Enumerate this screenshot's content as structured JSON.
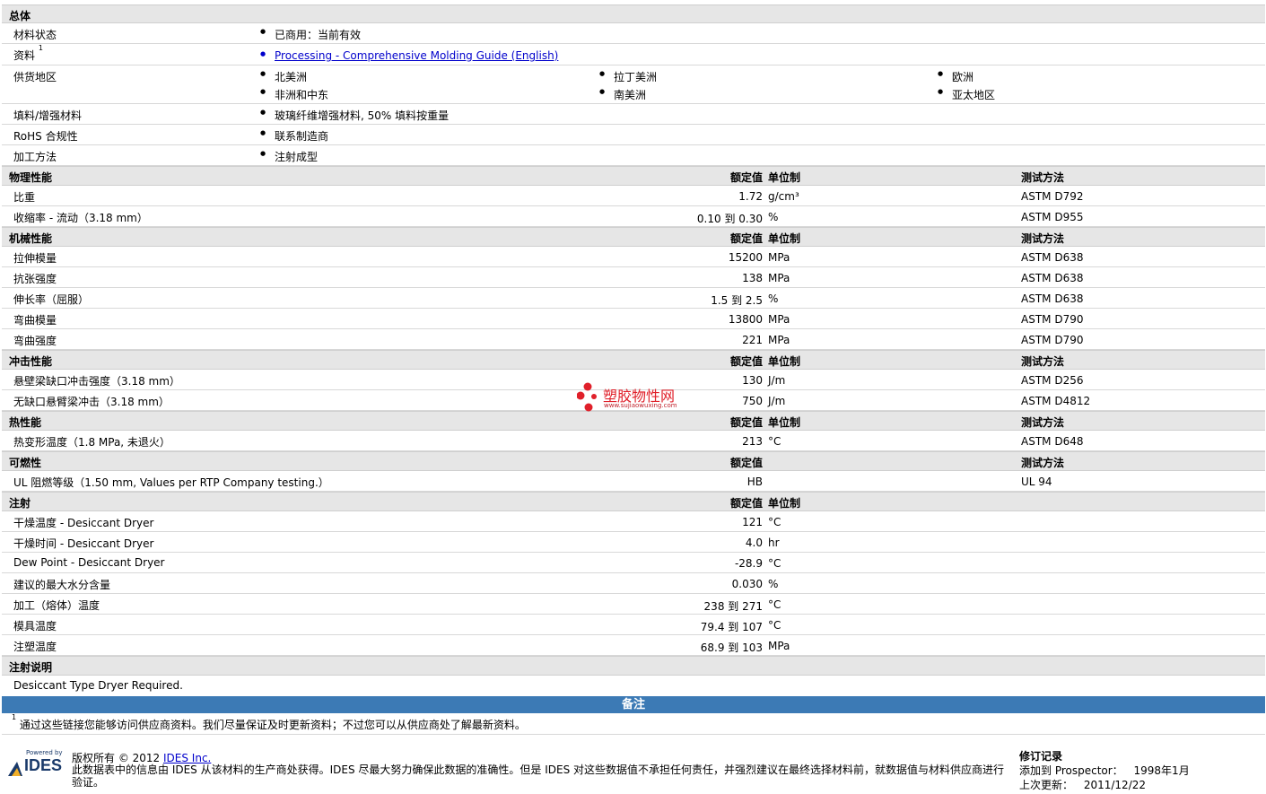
{
  "general": {
    "title": "总体",
    "rows": [
      {
        "label": "材料状态",
        "items": [
          "已商用：当前有效"
        ]
      },
      {
        "label": "资料",
        "sup": "1",
        "link": "Processing - Comprehensive Molding Guide (English)"
      },
      {
        "label": "供货地区",
        "regions": [
          "北美洲",
          "拉丁美洲",
          "欧洲",
          "非洲和中东",
          "南美洲",
          "亚太地区"
        ]
      },
      {
        "label": "填料/增强材料",
        "items": [
          "玻璃纤维增强材料, 50% 填料按重量"
        ]
      },
      {
        "label": "RoHS 合规性",
        "items": [
          "联系制造商"
        ]
      },
      {
        "label": "加工方法",
        "items": [
          "注射成型"
        ]
      }
    ]
  },
  "headers": {
    "nominal": "额定值",
    "unit": "单位制",
    "method": "测试方法"
  },
  "sections": [
    {
      "title": "物理性能",
      "show_unit": true,
      "show_method": true,
      "rows": [
        {
          "label": "比重",
          "value": "1.72",
          "unit": "g/cm³",
          "method": "ASTM D792"
        },
        {
          "label": "收缩率 - 流动（3.18 mm）",
          "value": "0.10 到  0.30",
          "unit": "%",
          "method": "ASTM D955"
        }
      ]
    },
    {
      "title": "机械性能",
      "show_unit": true,
      "show_method": true,
      "rows": [
        {
          "label": "拉伸模量",
          "value": "15200",
          "unit": "MPa",
          "method": "ASTM D638"
        },
        {
          "label": "抗张强度",
          "value": "138",
          "unit": "MPa",
          "method": "ASTM D638"
        },
        {
          "label": "伸长率（屈服）",
          "value": "1.5 到  2.5",
          "unit": "%",
          "method": "ASTM D638"
        },
        {
          "label": "弯曲模量",
          "value": "13800",
          "unit": "MPa",
          "method": "ASTM D790"
        },
        {
          "label": "弯曲强度",
          "value": "221",
          "unit": "MPa",
          "method": "ASTM D790"
        }
      ]
    },
    {
      "title": "冲击性能",
      "show_unit": true,
      "show_method": true,
      "rows": [
        {
          "label": "悬壁梁缺口冲击强度（3.18 mm）",
          "value": "130",
          "unit": "J/m",
          "method": "ASTM D256"
        },
        {
          "label": "无缺口悬臂梁冲击（3.18 mm）",
          "value": "750",
          "unit": "J/m",
          "method": "ASTM D4812"
        }
      ]
    },
    {
      "title": "热性能",
      "show_unit": true,
      "show_method": true,
      "rows": [
        {
          "label": "热变形温度（1.8 MPa, 未退火）",
          "value": "213",
          "unit": "°C",
          "method": "ASTM D648"
        }
      ]
    },
    {
      "title": "可燃性",
      "show_unit": false,
      "show_method": true,
      "rows": [
        {
          "label": "UL 阻燃等级（1.50 mm, Values per RTP Company testing.）",
          "value": "HB",
          "unit": "",
          "method": "UL 94"
        }
      ]
    },
    {
      "title": "注射",
      "show_unit": true,
      "show_method": false,
      "rows": [
        {
          "label": "干燥温度 - Desiccant Dryer",
          "value": "121",
          "unit": "°C",
          "method": ""
        },
        {
          "label": "干燥时间 - Desiccant Dryer",
          "value": "4.0",
          "unit": "hr",
          "method": ""
        },
        {
          "label": "Dew Point - Desiccant Dryer",
          "value": "-28.9",
          "unit": "°C",
          "method": ""
        },
        {
          "label": "建议的最大水分含量",
          "value": "0.030",
          "unit": "%",
          "method": ""
        },
        {
          "label": "加工（熔体）温度",
          "value": "238 到  271",
          "unit": "°C",
          "method": ""
        },
        {
          "label": "模具温度",
          "value": "79.4 到  107",
          "unit": "°C",
          "method": ""
        },
        {
          "label": "注塑温度",
          "value": "68.9 到  103",
          "unit": "MPa",
          "method": ""
        }
      ]
    }
  ],
  "injection_notes": {
    "title": "注射说明",
    "text": "Desiccant Type Dryer Required."
  },
  "notes": {
    "title": "备注",
    "sup": "1",
    "text": "通过这些链接您能够访问供应商资料。我们尽量保证及时更新资料；不过您可以从供应商处了解最新资料。"
  },
  "footer": {
    "powered_by": "Powered by",
    "logo": "IDES",
    "copyright": "版权所有 © 2012",
    "company_link": "IDES Inc.",
    "disclaimer": "此数据表中的信息由 IDES 从该材料的生产商处获得。IDES 尽最大努力确保此数据的准确性。但是 IDES 对这些数据值不承担任何责任，并强烈建议在最终选择材料前，就数据值与材料供应商进行验证。",
    "revision_title": "修订记录",
    "added_label": "添加到 Prospector：",
    "added_value": "1998年1月",
    "updated_label": "上次更新：",
    "updated_value": "2011/12/22"
  },
  "watermark": {
    "cn": "塑胶物性网",
    "en": "www.sujiaowuxing.com"
  },
  "colors": {
    "section_bg": "#e6e6e6",
    "notes_bar": "#3c7ab5",
    "link": "#0000cc",
    "watermark": "#e0202a"
  }
}
